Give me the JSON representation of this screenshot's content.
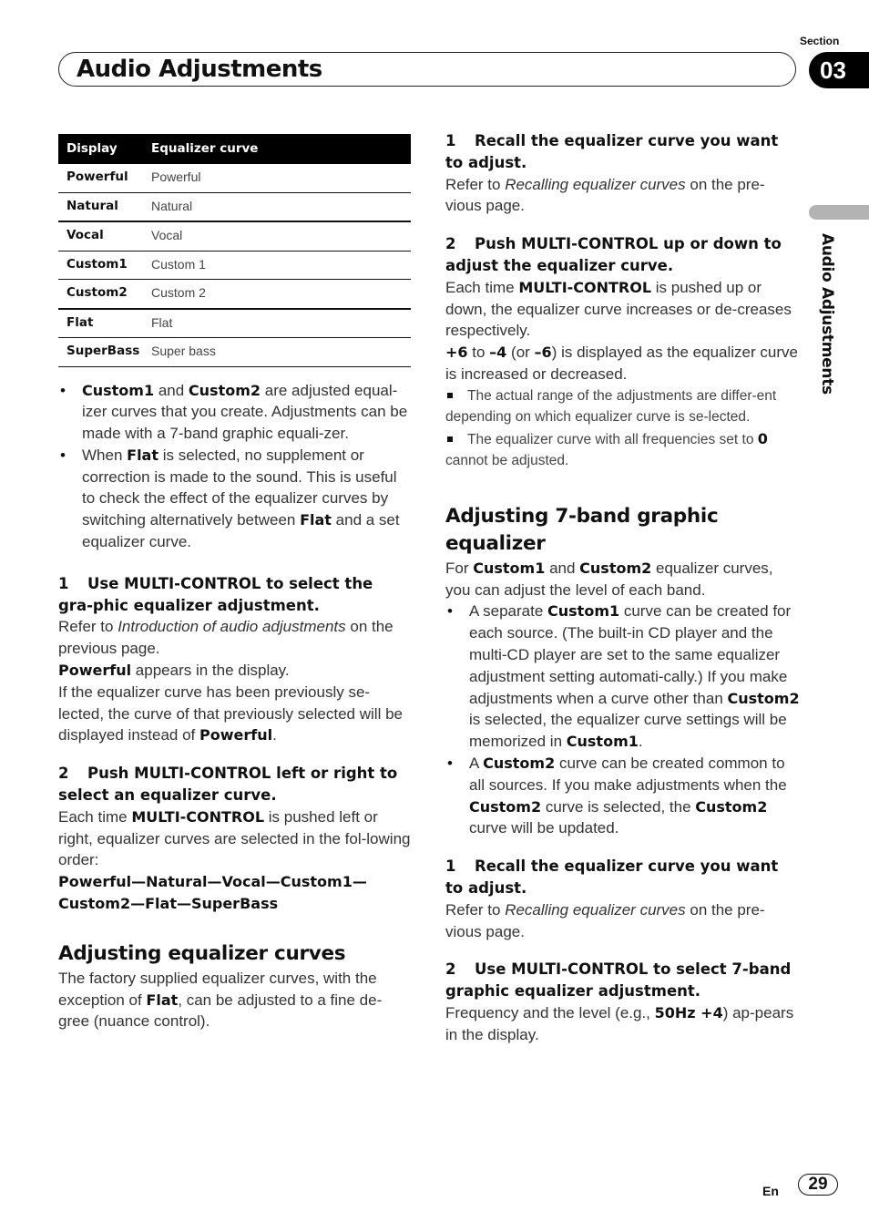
{
  "header": {
    "section_label": "Section",
    "section_number": "03",
    "title": "Audio Adjustments",
    "side_label": "Audio Adjustments"
  },
  "table": {
    "headers": [
      "Display",
      "Equalizer curve"
    ],
    "rows": [
      {
        "display": "Powerful",
        "curve": "Powerful"
      },
      {
        "display": "Natural",
        "curve": "Natural"
      },
      {
        "display": "Vocal",
        "curve": "Vocal"
      },
      {
        "display": "Custom1",
        "curve": "Custom 1"
      },
      {
        "display": "Custom2",
        "curve": "Custom 2"
      },
      {
        "display": "Flat",
        "curve": "Flat"
      },
      {
        "display": "SuperBass",
        "curve": "Super bass"
      }
    ]
  },
  "left": {
    "bullets": [
      {
        "b1": "Custom1",
        "t1": " and ",
        "b2": "Custom2",
        "t2": " are adjusted equal-izer curves that you create. Adjustments can be made with a 7-band graphic equali-zer."
      },
      {
        "t0": "When ",
        "b1": "Flat",
        "t1": " is selected, no supplement or correction is made to the sound. This is useful to check the effect of the equalizer curves by switching alternatively between ",
        "b2": "Flat",
        "t2": " and a set equalizer curve."
      }
    ],
    "step1": {
      "num": "1",
      "title": "Use MULTI-CONTROL to select the gra-phic equalizer adjustment.",
      "ref_pre": "Refer to ",
      "ref_italic": "Introduction of audio adjustments",
      "ref_post": " on the previous page.",
      "line2_bold": "Powerful",
      "line2_text": " appears in the display.",
      "line3_text": "If the equalizer curve has been previously se-lected, the curve of that previously selected will be displayed instead of ",
      "line3_bold": "Powerful",
      "line3_end": "."
    },
    "step2": {
      "num": "2",
      "title": "Push MULTI-CONTROL left or right to select an equalizer curve.",
      "body_pre": "Each time ",
      "body_bold": "MULTI-CONTROL",
      "body_post": " is pushed left or right, equalizer curves are selected in the fol-lowing order:",
      "order": "Powerful—Natural—Vocal—Custom1—Custom2—Flat—SuperBass"
    },
    "section_heading": "Adjusting equalizer curves",
    "section_body_pre": "The factory supplied equalizer curves, with the exception of ",
    "section_body_bold": "Flat",
    "section_body_post": ", can be adjusted to a fine de-gree (nuance control)."
  },
  "right": {
    "step1": {
      "num": "1",
      "title": "Recall the equalizer curve you want to adjust.",
      "ref_pre": "Refer to ",
      "ref_italic": "Recalling equalizer curves",
      "ref_post": " on the pre-vious page."
    },
    "step2": {
      "num": "2",
      "title": "Push MULTI-CONTROL up or down to adjust the equalizer curve.",
      "body_pre": "Each time ",
      "body_bold": "MULTI-CONTROL",
      "body_post": " is pushed up or down, the equalizer curve increases or de-creases respectively.",
      "range_b1": "+6",
      "range_t1": " to ",
      "range_b2": "–4",
      "range_t2": " (or ",
      "range_b3": "–6",
      "range_t3": ") is displayed as the equalizer curve is increased or decreased."
    },
    "notes": [
      {
        "text": "The actual range of the adjustments are differ-ent depending on which equalizer curve is se-lected."
      },
      {
        "text": "The equalizer curve with all frequencies set to ",
        "bold": "0",
        "end": " cannot be adjusted."
      }
    ],
    "section_heading": "Adjusting 7-band graphic equalizer",
    "intro_pre": "For ",
    "intro_b1": "Custom1",
    "intro_t1": " and ",
    "intro_b2": "Custom2",
    "intro_t2": " equalizer curves, you can adjust the level of each band.",
    "bullets": [
      {
        "t0": "A separate ",
        "b1": "Custom1",
        "t1": " curve can be created for each source. (The built-in CD player and the multi-CD player are set to the same equalizer adjustment setting automati-cally.) If you make adjustments when a curve other than ",
        "b2": "Custom2",
        "t2": " is selected, the equalizer curve settings will be memorized in ",
        "b3": "Custom1",
        "t3": "."
      },
      {
        "t0": "A ",
        "b1": "Custom2",
        "t1": " curve can be created common to all sources. If you make adjustments when the ",
        "b2": "Custom2",
        "t2": " curve is selected, the ",
        "b3": "Custom2",
        "t3": " curve will be updated."
      }
    ],
    "step3": {
      "num": "1",
      "title": "Recall the equalizer curve you want to adjust.",
      "ref_pre": "Refer to ",
      "ref_italic": "Recalling equalizer curves",
      "ref_post": " on the pre-vious page."
    },
    "step4": {
      "num": "2",
      "title": "Use MULTI-CONTROL to select 7-band graphic equalizer adjustment.",
      "body_pre": "Frequency and the level (e.g., ",
      "body_bold": "50Hz +4",
      "body_post": ") ap-pears in the display."
    }
  },
  "footer": {
    "lang": "En",
    "page": "29"
  }
}
